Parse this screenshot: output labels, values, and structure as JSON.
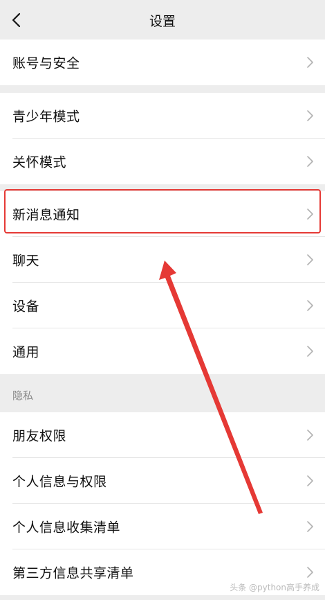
{
  "header": {
    "title": "设置",
    "back_icon": "chevron-left-icon"
  },
  "groups": [
    {
      "items": [
        {
          "label": "账号与安全"
        }
      ]
    },
    {
      "items": [
        {
          "label": "青少年模式"
        },
        {
          "label": "关怀模式"
        }
      ]
    },
    {
      "items": [
        {
          "label": "新消息通知"
        },
        {
          "label": "聊天"
        },
        {
          "label": "设备"
        },
        {
          "label": "通用"
        }
      ]
    }
  ],
  "privacy": {
    "header": "隐私",
    "items": [
      {
        "label": "朋友权限"
      },
      {
        "label": "个人信息与权限"
      },
      {
        "label": "个人信息收集清单"
      },
      {
        "label": "第三方信息共享清单"
      }
    ]
  },
  "annotation": {
    "highlight_color": "#e53935",
    "highlighted_item": "新消息通知"
  },
  "watermark": "头条 @python高手养成"
}
